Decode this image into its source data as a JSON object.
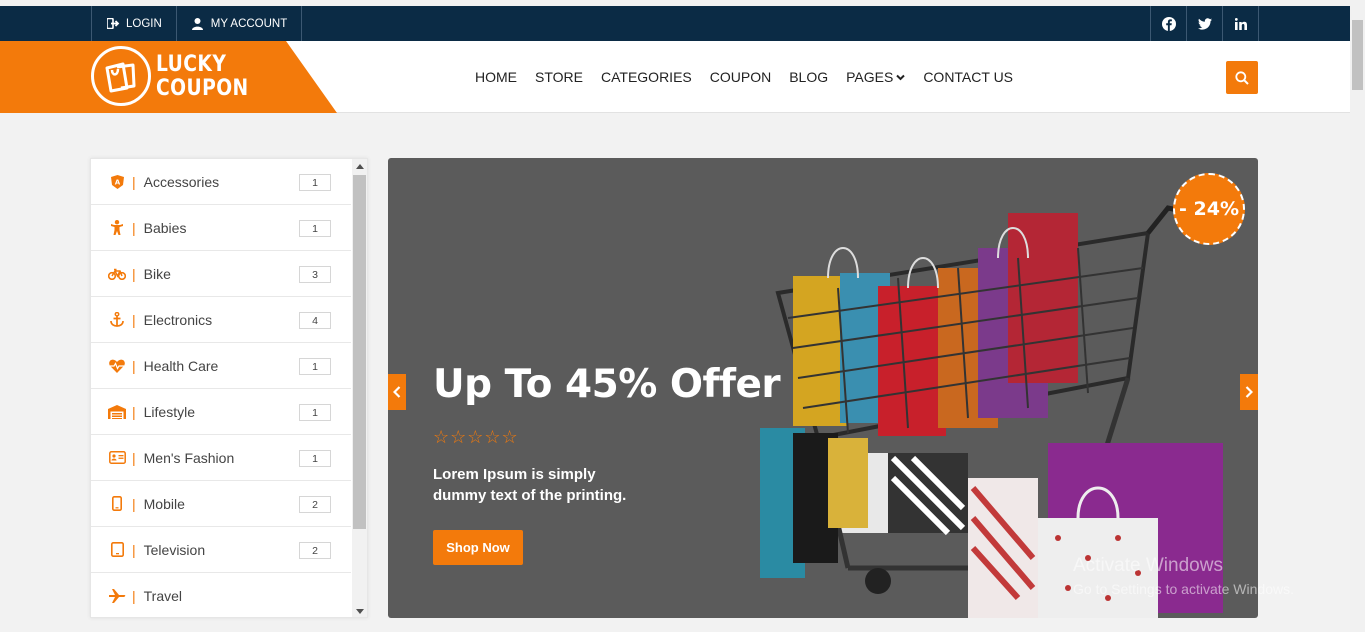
{
  "topbar": {
    "login_label": "LOGIN",
    "account_label": "MY ACCOUNT",
    "social": [
      "facebook-icon",
      "twitter-icon",
      "linkedin-icon"
    ]
  },
  "header": {
    "logo_line1": "LUCKY",
    "logo_line2": "COUPON",
    "nav": [
      "HOME",
      "STORE",
      "CATEGORIES",
      "COUPON",
      "BLOG",
      "PAGES",
      "CONTACT US"
    ],
    "accent_color": "#f37a0b",
    "topbar_color": "#0b2b45"
  },
  "sidebar": {
    "categories": [
      {
        "label": "Accessories",
        "count": "1",
        "icon": "shield-a-icon"
      },
      {
        "label": "Babies",
        "count": "1",
        "icon": "baby-icon"
      },
      {
        "label": "Bike",
        "count": "3",
        "icon": "bicycle-icon"
      },
      {
        "label": "Electronics",
        "count": "4",
        "icon": "anchor-icon"
      },
      {
        "label": "Health Care",
        "count": "1",
        "icon": "heartbeat-icon"
      },
      {
        "label": "Lifestyle",
        "count": "1",
        "icon": "warehouse-icon"
      },
      {
        "label": "Men's Fashion",
        "count": "1",
        "icon": "id-card-icon"
      },
      {
        "label": "Mobile",
        "count": "2",
        "icon": "mobile-icon"
      },
      {
        "label": "Television",
        "count": "2",
        "icon": "tablet-icon"
      },
      {
        "label": "Travel",
        "count": "",
        "icon": "plane-icon"
      }
    ]
  },
  "banner": {
    "headline": "Up To 45% Offer",
    "rating_stars": "☆☆☆☆☆",
    "desc_line1": "Lorem Ipsum is simply",
    "desc_line2": "dummy text of the printing.",
    "cta": "Shop Now",
    "badge": "- 24%"
  },
  "watermark": {
    "line1": "Activate Windows",
    "line2": "Go to Settings to activate Windows."
  }
}
